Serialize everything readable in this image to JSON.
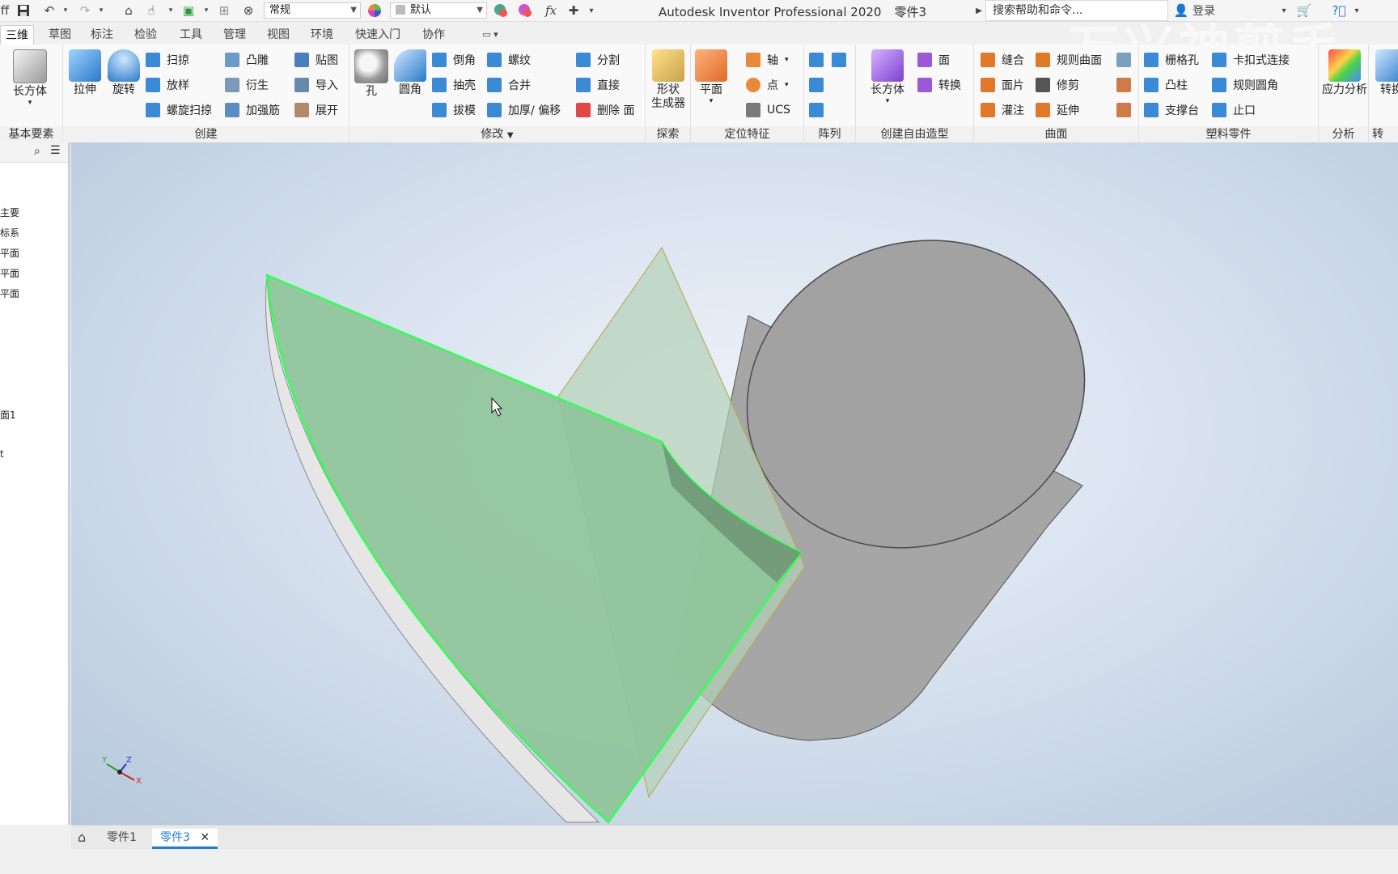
{
  "window": {
    "app_title": "Autodesk Inventor Professional 2020",
    "document_title": "零件3"
  },
  "quick_access": {
    "appearance_select": "常规",
    "material_select": "默认",
    "search_placeholder": "搜索帮助和命令...",
    "login_label": "登录"
  },
  "tabs": [
    "三维模型",
    "草图",
    "标注",
    "检验",
    "工具",
    "管理",
    "视图",
    "环境",
    "快速入门",
    "协作"
  ],
  "ribbon": {
    "basic": {
      "title": "基本要素",
      "box": "长方体"
    },
    "create": {
      "title": "创建",
      "extrude": "拉伸",
      "revolve": "旋转",
      "sweep": "扫掠",
      "loft": "放样",
      "coil": "螺旋扫掠",
      "emboss": "凸雕",
      "derive": "衍生",
      "rib": "加强筋",
      "decal": "贴图",
      "import": "导入",
      "unfold": "展开"
    },
    "modify": {
      "title": "修改",
      "hole": "孔",
      "fillet": "圆角",
      "chamfer": "倒角",
      "shell": "抽壳",
      "draft": "拔模",
      "thread": "螺纹",
      "combine": "合并",
      "thicken": "加厚/ 偏移",
      "split": "分割",
      "direct": "直接",
      "delete_face": "删除 面"
    },
    "explore": {
      "title": "探索",
      "shape_gen": "形状",
      "shape_gen2": "生成器"
    },
    "work_features": {
      "title": "定位特征",
      "plane": "平面",
      "axis": "轴",
      "point": "点",
      "ucs": "UCS"
    },
    "pattern": {
      "title": "阵列"
    },
    "freeform": {
      "title": "创建自由造型",
      "box": "长方体",
      "face": "面",
      "convert": "转换"
    },
    "surface": {
      "title": "曲面",
      "stitch": "缝合",
      "patch": "面片",
      "sculpt": "灌注",
      "ruled": "规则曲面",
      "trim": "修剪",
      "extend": "延伸"
    },
    "plastic": {
      "title": "塑料零件",
      "grill": "栅格孔",
      "boss": "凸柱",
      "rest": "支撑台",
      "snap_fit": "卡扣式连接",
      "rule_fillet": "规则圆角",
      "lip": "止口"
    },
    "analysis": {
      "title": "分析",
      "stress": "应力分析"
    },
    "convert": {
      "title": "转",
      "convert": "转换"
    }
  },
  "browser": {
    "items": [
      "主要",
      "标系",
      "平面",
      "平面",
      "平面",
      "面1",
      "t"
    ]
  },
  "doc_tabs": {
    "tab1": "零件1",
    "tab2": "零件3"
  },
  "viewcube": {
    "x_label": "X",
    "y_label": "Y",
    "z_label": "Z"
  },
  "watermark": "万兴神剪手",
  "colors": {
    "accent": "#1e7fd0",
    "selection_highlight": "#33ff55",
    "surface_fill": "#8fc49a",
    "cylinder": "#a9a9a9"
  }
}
